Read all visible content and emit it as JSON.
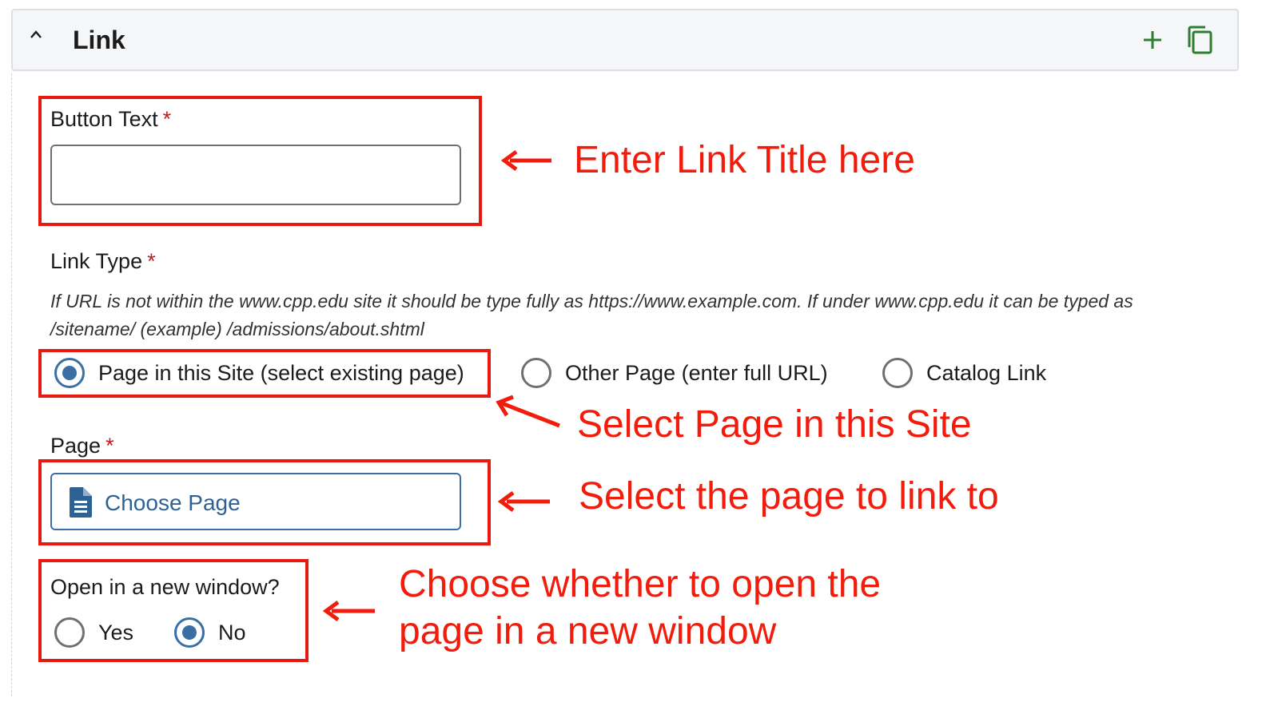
{
  "header": {
    "title": "Link",
    "icons": {
      "collapse": "chevron-up-icon",
      "add": "plus-icon",
      "duplicate": "copy-icon"
    }
  },
  "fields": {
    "button_text": {
      "label": "Button Text",
      "required_mark": "*",
      "value": ""
    },
    "link_type": {
      "label": "Link Type",
      "required_mark": "*",
      "help_line1": "If URL is not within the www.cpp.edu site it should be type fully as https://www.example.com. If under www.cpp.edu it can be typed as",
      "help_line2": "/sitename/ (example) /admissions/about.shtml",
      "options": [
        {
          "label": "Page in this Site (select existing page)",
          "selected": true
        },
        {
          "label": "Other Page (enter full URL)",
          "selected": false
        },
        {
          "label": "Catalog Link",
          "selected": false
        }
      ]
    },
    "page": {
      "label": "Page",
      "required_mark": "*",
      "button_label": "Choose Page",
      "icon": "document-icon"
    },
    "new_window": {
      "label": "Open in a new window?",
      "options": [
        {
          "label": "Yes",
          "selected": false
        },
        {
          "label": "No",
          "selected": true
        }
      ]
    }
  },
  "annotations": {
    "title": "Enter Link Title here",
    "select_site": "Select Page in this Site",
    "select_page": "Select the page to link to",
    "new_window_line1": "Choose whether to open the",
    "new_window_line2": "page in a new window"
  },
  "colors": {
    "annotation": "#f21c0d",
    "accent": "#3a6fa6",
    "required": "#c21b1b",
    "add_icon": "#2e7d32"
  }
}
